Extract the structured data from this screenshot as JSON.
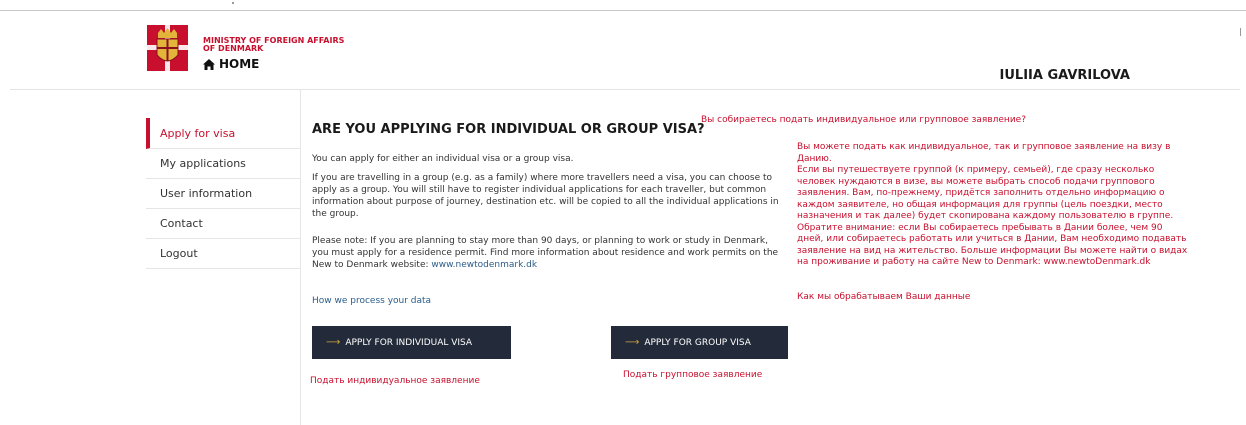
{
  "header": {
    "ministry_line1": "MINISTRY OF FOREIGN AFFAIRS",
    "ministry_line2": "OF DENMARK",
    "home_label": "HOME",
    "user_name": "IULIIA GAVRILOVA",
    "brand_color": "#c8102e"
  },
  "sidebar": {
    "items": [
      {
        "label": "Apply for visa",
        "active": true
      },
      {
        "label": "My applications"
      },
      {
        "label": "User information"
      },
      {
        "label": "Contact"
      },
      {
        "label": "Logout"
      }
    ]
  },
  "main": {
    "title": "ARE YOU APPLYING FOR INDIVIDUAL OR GROUP VISA?",
    "p1": "You can apply for either an individual visa or a group visa.",
    "p2": "If you are travelling in a group (e.g. as a family) where more travellers need a visa, you can choose to apply as a group. You will still have to register individual applications for each traveller, but common information about purpose of journey, destination etc. will be copied to all the individual applications in the group.",
    "p3_text": "Please note: If you are planning to stay more than 90 days, or planning to work or study in Denmark, you must apply for a residence permit. Find more information about residence and work permits on the New to Denmark website: ",
    "p3_link": "www.newtodenmark.dk",
    "process_link": "How we process your data",
    "btn_individual": "APPLY FOR INDIVIDUAL VISA",
    "btn_group": "APPLY FOR GROUP VISA",
    "button_color": "#232b3a"
  },
  "annotations": {
    "ru_question": "Вы собираетесь подать индивидуальное или групповое заявление?",
    "ru_body_lines": [
      "Вы можете подать как индивидуальное, так и групповое заявление на визу в",
      "Данию.",
      "Если вы путешествуете группой (к примеру, семьей), где сразу несколько",
      "человек нуждаются в визе, вы можете выбрать способ подачи группового",
      "заявления. Вам, по-прежнему, придётся заполнить отдельно информацию о",
      "каждом заявителе, но общая информация для группы (цель поездки, место",
      "назначения и так далее) будет скопирована каждому пользователю в группе.",
      "Обратите внимание: если Вы собираетесь пребывать в Дании более, чем 90",
      "дней, или собираетесь работать или учиться в Дании, Вам необходимо подавать",
      "заявление на вид на жительство. Больше информации Вы можете найти о видах",
      "на проживание и работу на сайте New to Denmark: www.newtoDenmark.dk"
    ],
    "ru_process": "Как мы обрабатываем Ваши данные",
    "ru_individual": "Подать индивидуальное заявление",
    "ru_group": "Подать групповое заявление",
    "annotation_color": "#c8102e"
  }
}
